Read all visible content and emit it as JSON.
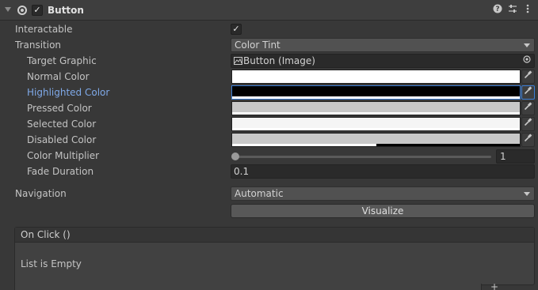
{
  "component": {
    "title": "Button",
    "enabled_check": "✓"
  },
  "fields": {
    "interactable": {
      "label": "Interactable",
      "check": "✓"
    },
    "transition": {
      "label": "Transition",
      "value": "Color Tint"
    },
    "target_graphic": {
      "label": "Target Graphic",
      "value": "Button (Image)"
    },
    "normal_color": {
      "label": "Normal Color",
      "color": "#ffffff",
      "alpha": 1.0
    },
    "highlighted_color": {
      "label": "Highlighted Color",
      "color": "#000000",
      "alpha": 1.0
    },
    "pressed_color": {
      "label": "Pressed Color",
      "color": "#c8c8c8",
      "alpha": 1.0
    },
    "selected_color": {
      "label": "Selected Color",
      "color": "#f5f5f5",
      "alpha": 1.0
    },
    "disabled_color": {
      "label": "Disabled Color",
      "color": "#c8c8c8",
      "alpha": 0.5
    },
    "color_multiplier": {
      "label": "Color Multiplier",
      "value": "1",
      "slider_min": 1,
      "slider_max": 5
    },
    "fade_duration": {
      "label": "Fade Duration",
      "value": "0.1"
    },
    "navigation": {
      "label": "Navigation",
      "value": "Automatic"
    },
    "visualize": {
      "label": "Visualize"
    }
  },
  "on_click": {
    "header": "On Click ()",
    "empty_text": "List is Empty",
    "add_symbol": "+"
  },
  "colors": {
    "panel_bg": "#383838",
    "highlight_label": "#7fa9e8",
    "active_picker_border": "#3d7fd6"
  }
}
